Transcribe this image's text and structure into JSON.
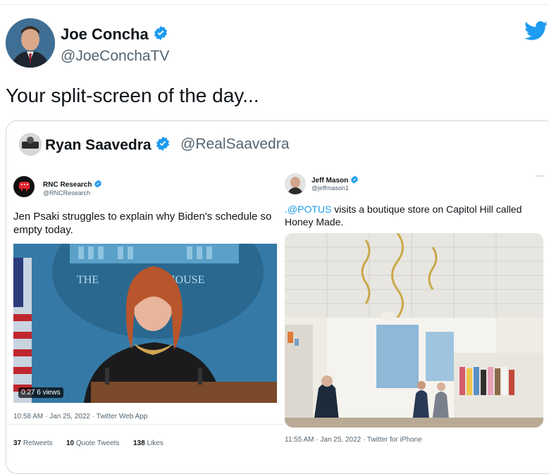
{
  "tweet": {
    "author_name": "Joe Concha",
    "author_handle": "@JoeConchaTV",
    "text": "Your split-screen of the day..."
  },
  "quoted": {
    "author_name": "Ryan Saavedra",
    "author_handle": "@RealSaavedra"
  },
  "left_embed": {
    "author_name": "RNC Research",
    "author_handle": "@RNCResearch",
    "text": "Jen Psaki struggles to explain why Biden's schedule so empty today.",
    "video_duration": "0:27",
    "video_views": "6 views",
    "timestamp": "10:58 AM · Jan 25, 2022 · Twitter Web App",
    "retweets_count": "37",
    "retweets_label": "Retweets",
    "quote_count": "10",
    "quote_label": "Quote Tweets",
    "likes_count": "138",
    "likes_label": "Likes",
    "scene_wall_text_left": "THE",
    "scene_wall_text_right": "HOUSE"
  },
  "right_embed": {
    "author_name": "Jeff Mason",
    "author_handle": "@jeffmason1",
    "mention": ".@POTUS",
    "text_rest": " visits a boutique store on Capitol Hill called Honey Made.",
    "timestamp": "11:55 AM · Jan 25, 2022 · Twitter for iPhone",
    "more_label": "···"
  },
  "colors": {
    "twitter_blue": "#1d9bf0",
    "text_primary": "#0f1419",
    "text_secondary": "#536471",
    "border": "#cfd9de"
  },
  "icons": {
    "verified": "verified-badge-icon",
    "twitter": "twitter-bird-icon",
    "rnc": "rnc-elephant-icon"
  }
}
